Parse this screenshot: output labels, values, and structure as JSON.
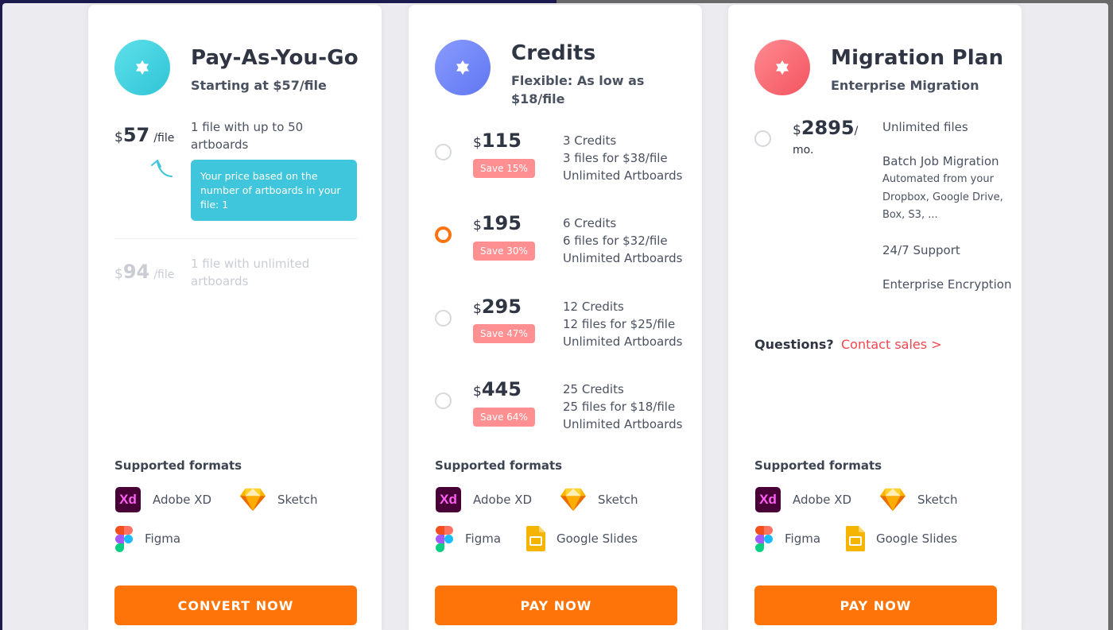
{
  "colors": {
    "accent": "#ff7408",
    "teal": "#3fc6dc",
    "blue": "#6c83f5",
    "red": "#f2545f",
    "save_badge": "#ff8f91",
    "link": "#f2464f"
  },
  "payg": {
    "title": "Pay-As-You-Go",
    "subtitle": "Starting at $57/file",
    "tier1": {
      "currency": "$",
      "amount": "57",
      "unit": "/file",
      "desc": "1 file with up to 50 artboards"
    },
    "tooltip": "Your price based on the number of artboards in your file: 1",
    "tier2": {
      "currency": "$",
      "amount": "94",
      "unit": "/file",
      "desc": "1 file with unlimited artboards"
    },
    "cta": "CONVERT NOW"
  },
  "credits": {
    "title": "Credits",
    "subtitle": "Flexible: As low as $18/file",
    "options": [
      {
        "currency": "$",
        "amount": "115",
        "save": "Save 15%",
        "line1": "3 Credits",
        "line2": "3 files for $38/file",
        "line3": "Unlimited Artboards"
      },
      {
        "currency": "$",
        "amount": "195",
        "save": "Save 30%",
        "line1": "6 Credits",
        "line2": "6 files for $32/file",
        "line3": "Unlimited Artboards"
      },
      {
        "currency": "$",
        "amount": "295",
        "save": "Save 47%",
        "line1": "12 Credits",
        "line2": "12 files for $25/file",
        "line3": "Unlimited Artboards"
      },
      {
        "currency": "$",
        "amount": "445",
        "save": "Save 64%",
        "line1": "25 Credits",
        "line2": "25 files for $18/file",
        "line3": "Unlimited Artboards"
      }
    ],
    "selected_option": 1,
    "cta": "PAY NOW"
  },
  "migration": {
    "title": "Migration Plan",
    "subtitle": "Enterprise Migration",
    "price": {
      "currency": "$",
      "amount": "2895",
      "unit": "/",
      "period": "mo."
    },
    "features": {
      "f1": "Unlimited files",
      "f2": "Batch Job Migration",
      "f2_detail": "Automated from your Dropbox, Google Drive, Box, S3, ...",
      "f3": "24/7 Support",
      "f4": "Enterprise Encryption"
    },
    "questions": "Questions?",
    "contact": "Contact sales >",
    "cta": "PAY NOW"
  },
  "formats": {
    "title": "Supported formats",
    "xd": "Adobe XD",
    "xd_icon_text": "Xd",
    "sketch": "Sketch",
    "figma": "Figma",
    "slides": "Google Slides"
  },
  "icons": {
    "plan_badge": "star-of-david-icon",
    "arrow": "curved-arrow-up-icon",
    "xd": "adobe-xd-icon",
    "sketch": "sketch-diamond-icon",
    "figma": "figma-icon",
    "slides": "google-slides-icon"
  }
}
